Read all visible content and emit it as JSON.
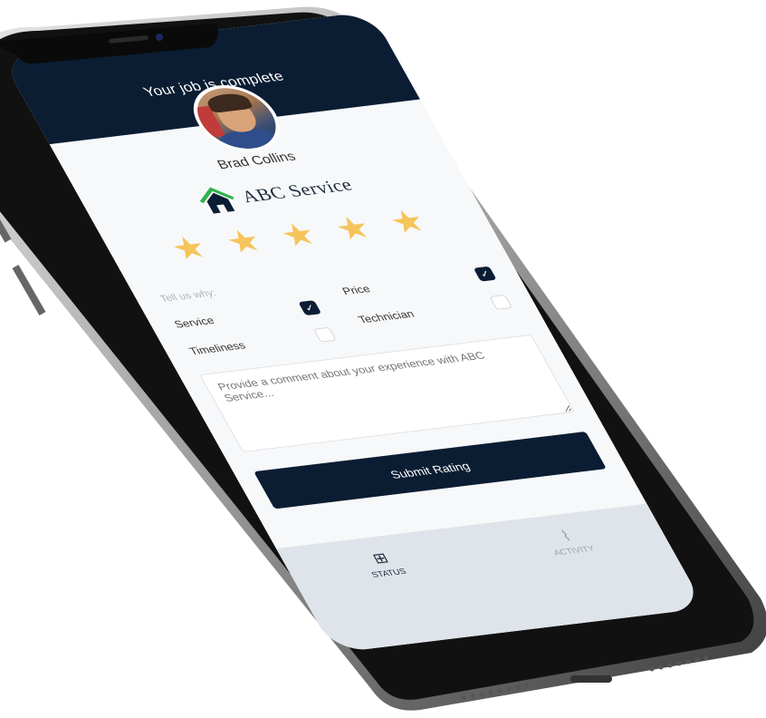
{
  "header": {
    "title": "Your job is complete"
  },
  "technician": {
    "name": "Brad Collins"
  },
  "company": {
    "name": "ABC Service"
  },
  "rating": {
    "stars": 5,
    "max": 5
  },
  "reasons": {
    "label": "Tell us why:",
    "options": [
      {
        "label": "Service",
        "checked": true
      },
      {
        "label": "Price",
        "checked": true
      },
      {
        "label": "Timeliness",
        "checked": false
      },
      {
        "label": "Technician",
        "checked": false
      }
    ]
  },
  "comment": {
    "placeholder": "Provide a comment about your experience with ABC Service..."
  },
  "submit": {
    "label": "Submit Rating"
  },
  "tabs": [
    {
      "label": "STATUS",
      "icon": "status-icon",
      "active": true
    },
    {
      "label": "ACTIVITY",
      "icon": "activity-icon",
      "active": false
    }
  ],
  "colors": {
    "navy": "#0b1d33",
    "star": "#f5c45a",
    "brand_green": "#2fb34a"
  }
}
